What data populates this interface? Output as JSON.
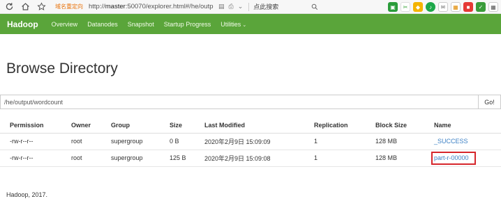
{
  "browser": {
    "prefix_label": "域名重定向",
    "url_scheme": "http://",
    "url_host": "master",
    "url_rest": ":50070/explorer.html#/he/outp",
    "search_placeholder": "点此搜索",
    "accent_color": "#e8730c"
  },
  "navbar": {
    "brand": "Hadoop",
    "items": [
      {
        "label": "Overview"
      },
      {
        "label": "Datanodes"
      },
      {
        "label": "Snapshot"
      },
      {
        "label": "Startup Progress"
      },
      {
        "label": "Utilities"
      }
    ],
    "utilities_caret": "⌄",
    "bg_color": "#5aa53a"
  },
  "page": {
    "title": "Browse Directory"
  },
  "path": {
    "value": "/he/output/wordcount",
    "go_label": "Go!"
  },
  "table": {
    "headers": [
      "Permission",
      "Owner",
      "Group",
      "Size",
      "Last Modified",
      "Replication",
      "Block Size",
      "Name"
    ],
    "rows": [
      {
        "permission": "-rw-r--r--",
        "owner": "root",
        "group": "supergroup",
        "size": "0 B",
        "modified": "2020年2月9日 15:09:09",
        "replication": "1",
        "block_size": "128 MB",
        "name": "_SUCCESS"
      },
      {
        "permission": "-rw-r--r--",
        "owner": "root",
        "group": "supergroup",
        "size": "125 B",
        "modified": "2020年2月9日 15:09:08",
        "replication": "1",
        "block_size": "128 MB",
        "name": "part-r-00000"
      }
    ],
    "link_color": "#3a7fc4",
    "highlight_color": "#d6262b"
  },
  "footer": {
    "text": "Hadoop, 2017."
  }
}
